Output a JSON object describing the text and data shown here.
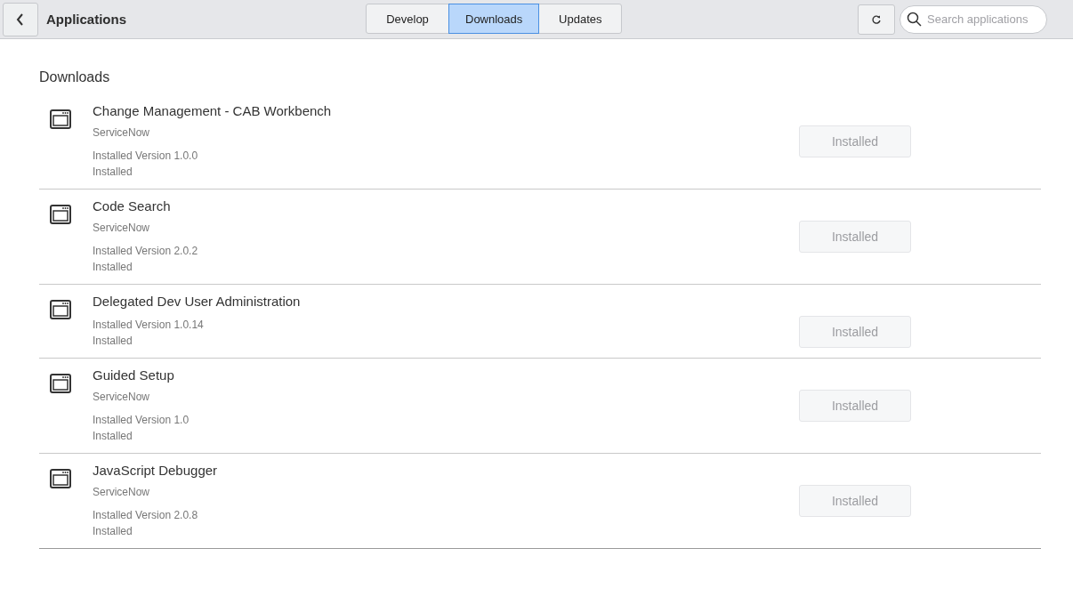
{
  "header": {
    "title": "Applications",
    "tabs": [
      {
        "label": "Develop",
        "selected": false
      },
      {
        "label": "Downloads",
        "selected": true
      },
      {
        "label": "Updates",
        "selected": false
      }
    ],
    "search": {
      "placeholder": "Search applications"
    }
  },
  "section_title": "Downloads",
  "apps": [
    {
      "name": "Change Management - CAB Workbench",
      "vendor": "ServiceNow",
      "version": "Installed Version 1.0.0",
      "status": "Installed",
      "button": {
        "label": "Installed",
        "disabled": true
      }
    },
    {
      "name": "Code Search",
      "vendor": "ServiceNow",
      "version": "Installed Version 2.0.2",
      "status": "Installed",
      "button": {
        "label": "Installed",
        "disabled": true
      }
    },
    {
      "name": "Delegated Dev User Administration",
      "version": "Installed Version 1.0.14",
      "status": "Installed",
      "button": {
        "label": "Installed",
        "disabled": true
      }
    },
    {
      "name": "Guided Setup",
      "vendor": "ServiceNow",
      "version": "Installed Version 1.0",
      "status": "Installed",
      "button": {
        "label": "Installed",
        "disabled": true
      }
    },
    {
      "name": "JavaScript Debugger",
      "vendor": "ServiceNow",
      "version": "Installed Version 2.0.8",
      "status": "Installed",
      "button": {
        "label": "Installed",
        "disabled": true
      }
    }
  ]
}
